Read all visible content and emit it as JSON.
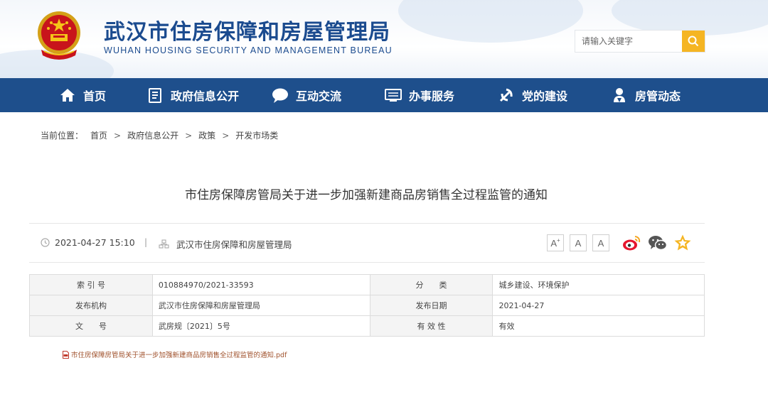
{
  "header": {
    "title": "武汉市住房保障和房屋管理局",
    "subtitle": "WUHAN HOUSING SECURITY AND MANAGEMENT BUREAU",
    "search_placeholder": "请输入关键字",
    "emblem_icon": "national-emblem-icon",
    "search_icon": "search-icon"
  },
  "colors": {
    "brand_blue": "#1e4f8c",
    "accent_yellow": "#f5b523",
    "title_blue": "#1b4b8f"
  },
  "nav": {
    "items": [
      {
        "label": "首页",
        "icon": "home-icon"
      },
      {
        "label": "政府信息公开",
        "icon": "document-icon"
      },
      {
        "label": "互动交流",
        "icon": "chat-bubble-icon"
      },
      {
        "label": "办事服务",
        "icon": "monitor-icon"
      },
      {
        "label": "党的建设",
        "icon": "party-emblem-icon"
      },
      {
        "label": "房管动态",
        "icon": "person-icon"
      }
    ]
  },
  "breadcrumb": {
    "prefix": "当前位置：",
    "items": [
      "首页",
      "政府信息公开",
      "政策",
      "开发市场类"
    ],
    "separator": ">"
  },
  "article": {
    "title": "市住房保障房管局关于进一步加强新建商品房销售全过程监管的通知",
    "date": "2021-04-27 15:10",
    "divider": "|",
    "source": "武汉市住房保障和房屋管理局",
    "font_sizes": [
      "A",
      "A",
      "A"
    ],
    "share_icons": [
      "weibo-icon",
      "wechat-icon",
      "favorite-star-icon"
    ]
  },
  "info_table": {
    "rows": [
      {
        "label1": "索 引 号",
        "value1": "010884970/2021-33593",
        "label2": "分　　类",
        "value2": "城乡建设、环境保护"
      },
      {
        "label1": "发布机构",
        "value1": "武汉市住房保障和房屋管理局",
        "label2": "发布日期",
        "value2": "2021-04-27"
      },
      {
        "label1": "文　　号",
        "value1": "武房规〔2021〕5号",
        "label2": "有 效 性",
        "value2": "有效"
      }
    ]
  },
  "attachment": {
    "label": "市住房保障房管局关于进一步加强新建商品房销售全过程监管的通知.pdf",
    "icon": "pdf-file-icon"
  }
}
